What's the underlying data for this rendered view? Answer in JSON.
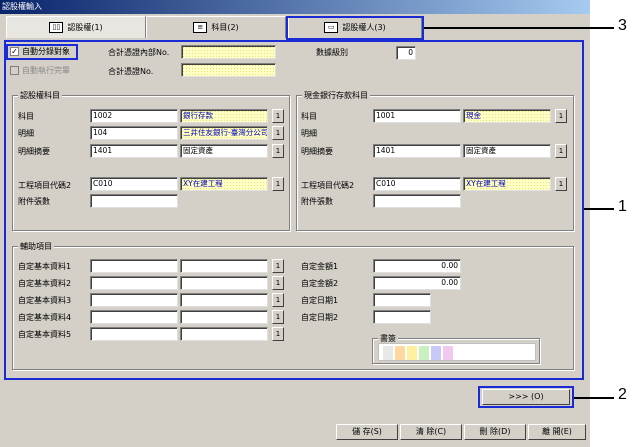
{
  "window": {
    "title": "認股權輸入"
  },
  "tabs": [
    {
      "label": "認股權(1)",
      "icon": "book-icon"
    },
    {
      "label": "科目(2)",
      "icon": "document-icon"
    },
    {
      "label": "認股權人(3)",
      "icon": "card-icon"
    }
  ],
  "top": {
    "auto_split_label": "自動分錄對象",
    "auto_split_checked": "✓",
    "auto_exec_label": "自動執行完畢",
    "acct_transfer_no_label": "合計憑證內部No.",
    "acct_transfer_no2_label": "合計憑證No.",
    "data_level_label": "數據級別",
    "data_level_value": "0"
  },
  "stock_subject": {
    "title": "認股權科目",
    "subject_label": "科目",
    "subject_code": "1002",
    "subject_name": "銀行存款",
    "detail_label": "明細",
    "detail_code": "104",
    "detail_name": "三井住友銀行-臺灣分公司",
    "detail_summary_label": "明細摘要",
    "detail_summary_code": "1401",
    "detail_summary_name": "固定資產",
    "project_code_label": "工程項目代碼2",
    "project_code": "C010",
    "project_name": "XY在建工程",
    "attachments_label": "附件張數"
  },
  "cash_subject": {
    "title": "現金銀行存款科目",
    "subject_label": "科目",
    "subject_code": "1001",
    "subject_name": "現金",
    "detail_label": "明細",
    "detail_summary_label": "明細摘要",
    "detail_summary_code": "1401",
    "detail_summary_name": "固定資產",
    "project_code_label": "工程項目代碼2",
    "project_code": "C010",
    "project_name": "XY在建工程",
    "attachments_label": "附件張數"
  },
  "aux": {
    "title": "輔助項目",
    "custom_basic_1": "自定基本資料1",
    "custom_basic_2": "自定基本資料2",
    "custom_basic_3": "自定基本資料3",
    "custom_basic_4": "自定基本資料4",
    "custom_basic_5": "自定基本資料5",
    "custom_amount_1": "自定金額1",
    "custom_amount_1_value": "0.00",
    "custom_amount_2": "自定金額2",
    "custom_amount_2_value": "0.00",
    "custom_date_1": "自定日期1",
    "custom_date_2": "自定日期2",
    "book_label": "書簽"
  },
  "lookup_label": "1",
  "next_button": ">>> (O)",
  "footer": {
    "save": "儲 存(S)",
    "clear": "清 除(C)",
    "delete": "刪 除(D)",
    "close": "離 開(E)"
  },
  "callouts": {
    "one": "1",
    "two": "2",
    "three": "3"
  }
}
